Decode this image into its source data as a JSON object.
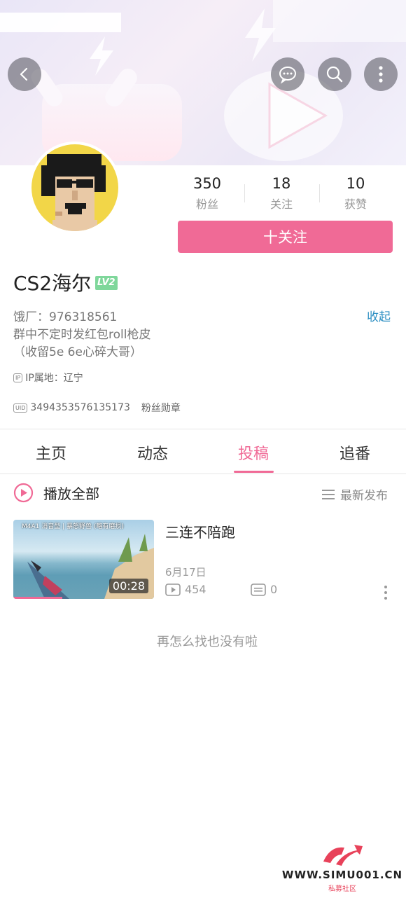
{
  "header": {
    "back_icon": "back-icon",
    "message_icon": "message-icon",
    "search_icon": "search-icon",
    "more_icon": "more-vertical-icon"
  },
  "stats": {
    "followers_count": "350",
    "followers_label": "粉丝",
    "following_count": "18",
    "following_label": "关注",
    "likes_count": "10",
    "likes_label": "获赞"
  },
  "follow_button": "十关注",
  "profile": {
    "name": "CS2海尔",
    "level": "LV2",
    "bio_line1": "饿厂：976318561",
    "bio_line2": "群中不定时发红包roll枪皮",
    "bio_line3": "（收留5e 6e心碎大哥）",
    "collapse": "收起",
    "ip_icon_text": "IP",
    "ip_location": "IP属地：辽宁",
    "uid_icon_text": "UID",
    "uid": "3494353576135173",
    "fan_badge": "粉丝勋章"
  },
  "tabs": [
    "主页",
    "动态",
    "投稿",
    "追番"
  ],
  "active_tab": "投稿",
  "list_header": {
    "play_all": "播放全部",
    "sort": "最新发布"
  },
  "video": {
    "title": "三连不陪跑",
    "thumb_text": "M4A1 消音型 | 暴怒野兽 (略有磨损)",
    "duration": "00:28",
    "date": "6月17日",
    "plays": "454",
    "comments": "0",
    "progress": 0.35
  },
  "empty_text": "再怎么找也没有啦",
  "watermark": {
    "site": "WWW.SIMU001.CN",
    "sub": "私募社区"
  },
  "colors": {
    "accent": "#f06a96",
    "link": "#2b8ec2",
    "level_badge": "#7fd79b"
  }
}
